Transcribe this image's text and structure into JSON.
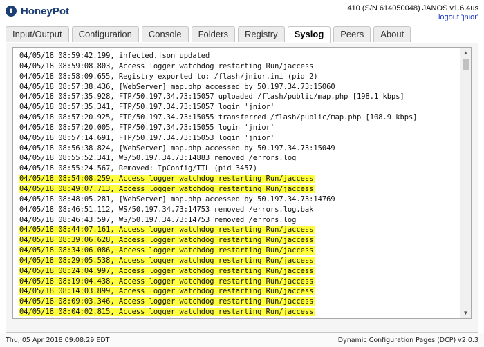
{
  "header": {
    "app_title": "HoneyPot",
    "logo_glyph": "i",
    "device_info": "410 (S/N 614050048) JANOS v1.6.4us",
    "logout_label": "logout 'jnior'"
  },
  "tabs": [
    {
      "label": "Input/Output",
      "active": false
    },
    {
      "label": "Configuration",
      "active": false
    },
    {
      "label": "Console",
      "active": false
    },
    {
      "label": "Folders",
      "active": false
    },
    {
      "label": "Registry",
      "active": false
    },
    {
      "label": "Syslog",
      "active": true
    },
    {
      "label": "Peers",
      "active": false
    },
    {
      "label": "About",
      "active": false
    }
  ],
  "log": {
    "highlight_color": "#ffff40",
    "lines": [
      {
        "text": "04/05/18 08:59:42.199, infected.json updated",
        "highlight": false
      },
      {
        "text": "04/05/18 08:59:08.803, Access logger watchdog restarting Run/jaccess",
        "highlight": false
      },
      {
        "text": "04/05/18 08:58:09.655, Registry exported to: /flash/jnior.ini (pid 2)",
        "highlight": false
      },
      {
        "text": "04/05/18 08:57:38.436, [WebServer] map.php accessed by 50.197.34.73:15060",
        "highlight": false
      },
      {
        "text": "04/05/18 08:57:35.928, FTP/50.197.34.73:15057 uploaded /flash/public/map.php [198.1 kbps]",
        "highlight": false
      },
      {
        "text": "04/05/18 08:57:35.341, FTP/50.197.34.73:15057 login 'jnior'",
        "highlight": false
      },
      {
        "text": "04/05/18 08:57:20.925, FTP/50.197.34.73:15055 transferred /flash/public/map.php [108.9 kbps]",
        "highlight": false
      },
      {
        "text": "04/05/18 08:57:20.005, FTP/50.197.34.73:15055 login 'jnior'",
        "highlight": false
      },
      {
        "text": "04/05/18 08:57:14.691, FTP/50.197.34.73:15053 login 'jnior'",
        "highlight": false
      },
      {
        "text": "04/05/18 08:56:38.824, [WebServer] map.php accessed by 50.197.34.73:15049",
        "highlight": false
      },
      {
        "text": "04/05/18 08:55:52.341, WS/50.197.34.73:14883 removed /errors.log",
        "highlight": false
      },
      {
        "text": "04/05/18 08:55:24.567, Removed: IpConfig/TTL (pid 3457)",
        "highlight": false
      },
      {
        "text": "04/05/18 08:54:08.259, Access logger watchdog restarting Run/jaccess",
        "highlight": true
      },
      {
        "text": "04/05/18 08:49:07.713, Access logger watchdog restarting Run/jaccess",
        "highlight": true
      },
      {
        "text": "04/05/18 08:48:05.281, [WebServer] map.php accessed by 50.197.34.73:14769",
        "highlight": false
      },
      {
        "text": "04/05/18 08:46:51.112, WS/50.197.34.73:14753 removed /errors.log.bak",
        "highlight": false
      },
      {
        "text": "04/05/18 08:46:43.597, WS/50.197.34.73:14753 removed /errors.log",
        "highlight": false
      },
      {
        "text": "04/05/18 08:44:07.161, Access logger watchdog restarting Run/jaccess",
        "highlight": true
      },
      {
        "text": "04/05/18 08:39:06.628, Access logger watchdog restarting Run/jaccess",
        "highlight": true
      },
      {
        "text": "04/05/18 08:34:06.086, Access logger watchdog restarting Run/jaccess",
        "highlight": true
      },
      {
        "text": "04/05/18 08:29:05.538, Access logger watchdog restarting Run/jaccess",
        "highlight": true
      },
      {
        "text": "04/05/18 08:24:04.997, Access logger watchdog restarting Run/jaccess",
        "highlight": true
      },
      {
        "text": "04/05/18 08:19:04.438, Access logger watchdog restarting Run/jaccess",
        "highlight": true
      },
      {
        "text": "04/05/18 08:14:03.899, Access logger watchdog restarting Run/jaccess",
        "highlight": true
      },
      {
        "text": "04/05/18 08:09:03.346, Access logger watchdog restarting Run/jaccess",
        "highlight": true
      },
      {
        "text": "04/05/18 08:04:02.815, Access logger watchdog restarting Run/jaccess",
        "highlight": true
      }
    ]
  },
  "scrollbar": {
    "up_glyph": "▲",
    "down_glyph": "▼"
  },
  "footer": {
    "timestamp": "Thu, 05 Apr 2018 09:08:29 EDT",
    "version": "Dynamic Configuration Pages (DCP) v2.0.3"
  }
}
